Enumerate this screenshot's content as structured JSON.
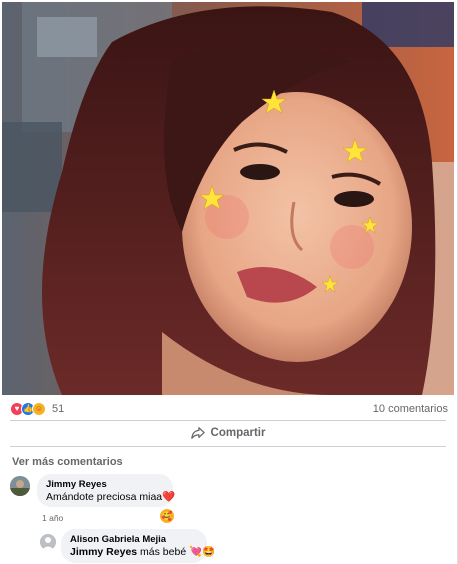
{
  "reactions": {
    "count": "51",
    "icons": [
      "love-icon",
      "like-icon",
      "care-icon"
    ],
    "comments_count": "10 comentarios"
  },
  "actions": {
    "share_label": "Compartir"
  },
  "comments": {
    "see_more": "Ver más comentarios",
    "items": [
      {
        "author": "Jimmy Reyes",
        "text": "Amándote preciosa miaa",
        "emoji": "❤️",
        "time": "1 año",
        "reaction": "🥰"
      }
    ],
    "replies": [
      {
        "author": "Alison Gabriela Mejia",
        "mention": "Jimmy Reyes",
        "text": " más bebé",
        "emoji": "💘🤩"
      }
    ]
  },
  "colors": {
    "love": "#f33e58",
    "like": "#1877f2",
    "care": "#f7b125",
    "secondary_text": "#65676b",
    "bubble": "#f0f2f5"
  }
}
